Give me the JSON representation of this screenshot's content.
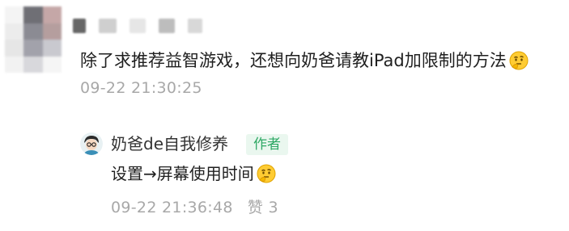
{
  "comment": {
    "text": "除了求推荐益智游戏，还想向奶爸请教iPad加限制的方法",
    "emoji": "thinking-face-emoji",
    "timestamp": "09-22 21:30:25"
  },
  "reply": {
    "author": "奶爸de自我修养",
    "badge": "作者",
    "text": "设置→屏幕使用时间",
    "emoji": "thinking-face-emoji",
    "timestamp": "09-22 21:36:48",
    "like_label": "赞",
    "like_count": "3"
  },
  "colors": {
    "text": "#1f1f1f",
    "meta": "#a8a8a8",
    "badge_bg": "#eaf7ef",
    "badge_text": "#2fa865"
  }
}
